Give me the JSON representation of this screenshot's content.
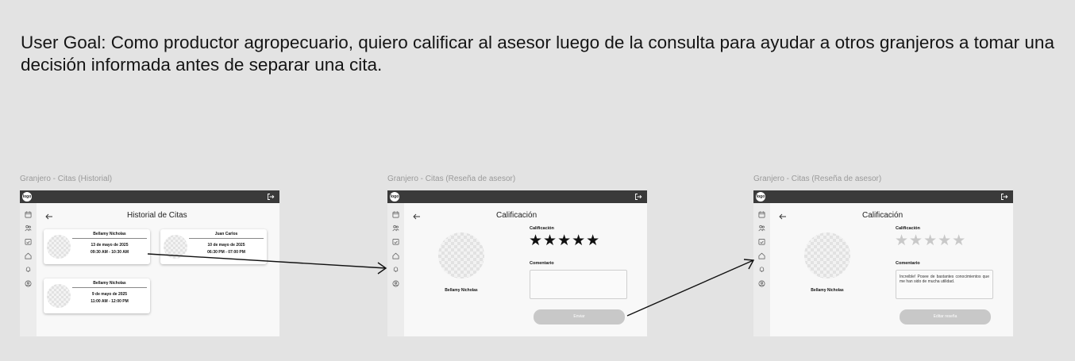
{
  "user_goal": "User Goal: Como productor agropecuario, quiero calificar al asesor luego de la consulta para ayudar a otros granjeros a tomar una decisión informada antes de separar una cita.",
  "common": {
    "logo": "logo"
  },
  "frames": [
    {
      "label": "Granjero - Citas (Historial)",
      "title": "Historial de Citas",
      "cards": [
        {
          "name": "Bellamy Nicholas",
          "date": "13 de mayo de 2025",
          "time": "09:30 AM - 10:30 AM"
        },
        {
          "name": "Juan Carlos",
          "date": "10 de mayo de 2025",
          "time": "06:30 PM - 07:00 PM"
        },
        {
          "name": "Bellamy Nicholas",
          "date": "9 de mayo de 2025",
          "time": "11:00 AM - 12:00 PM"
        }
      ]
    },
    {
      "label": "Granjero - Citas (Reseña de asesor)",
      "title": "Calificación",
      "advisor_name": "Bellamy Nicholas",
      "rating_label": "Calificación",
      "rating": 5,
      "stars": "★★★★★",
      "comment_label": "Comentario",
      "comment": "",
      "button": "Enviar"
    },
    {
      "label": "Granjero - Citas (Reseña de asesor)",
      "title": "Calificación",
      "advisor_name": "Bellamy Nicholas",
      "rating_label": "Calificación",
      "rating": 0,
      "stars": "★★★★★",
      "comment_label": "Comentario",
      "comment": "Increible! Posee de bastantes conocimientos que me han sido de mucha utilidad.",
      "button": "Editar reseña"
    }
  ],
  "colors": {
    "background": "#e3e3e3",
    "topbar": "#3a3a3a",
    "button": "#c8c8c8"
  }
}
